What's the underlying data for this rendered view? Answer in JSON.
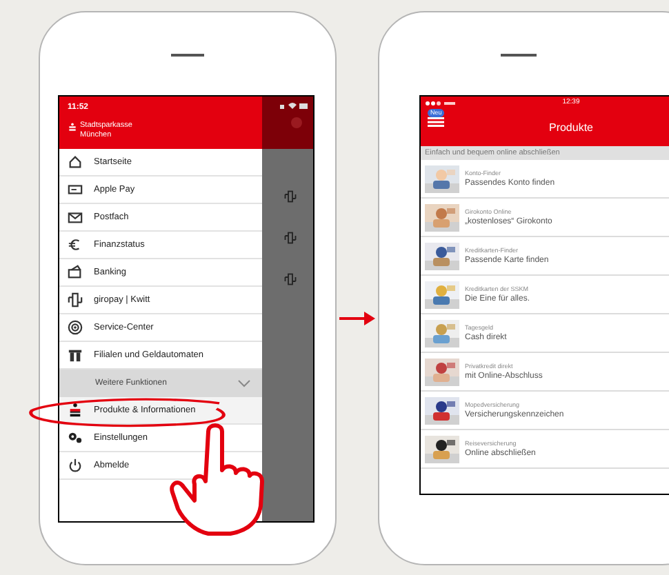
{
  "left_phone": {
    "status_time": "11:52",
    "bank_name": "Stadtsparkasse München",
    "menu_items": [
      {
        "label": "Startseite"
      },
      {
        "label": "Apple Pay"
      },
      {
        "label": "Postfach"
      },
      {
        "label": "Finanzstatus"
      },
      {
        "label": "Banking"
      },
      {
        "label": "giropay | Kwitt"
      },
      {
        "label": "Service-Center"
      },
      {
        "label": "Filialen und Geldautomaten"
      }
    ],
    "section": {
      "label": "Weitere Funktionen",
      "expanded": true
    },
    "more_items": [
      {
        "label": "Produkte & Informationen",
        "selected": true
      },
      {
        "label": "Einstellungen",
        "selected": false
      },
      {
        "label": "Abmelde",
        "selected": false
      }
    ]
  },
  "right_phone": {
    "status_time": "12:39",
    "badge": "Neu",
    "title": "Produkte",
    "subtitle": "Einfach und bequem online abschließen",
    "products": [
      {
        "kind": "picture",
        "caption": "Konto-Finder",
        "title": "Passendes Konto finden"
      },
      {
        "kind": "picture",
        "caption": "Girokonto Online",
        "title": "„kostenloses“ Girokonto"
      },
      {
        "kind": "picture",
        "caption": "Kreditkarten-Finder",
        "title": "Passende Karte finden"
      },
      {
        "kind": "picture",
        "caption": "Kreditkarten der SSKM",
        "title": "Die Eine für alles."
      },
      {
        "kind": "picture",
        "caption": "Tagesgeld",
        "title": "Cash direkt"
      },
      {
        "kind": "picture",
        "caption": "Privatkredit direkt",
        "title": "mit Online-Abschluss"
      },
      {
        "kind": "picture",
        "caption": "Mopedversicherung",
        "title": "Versicherungskennzeichen"
      },
      {
        "kind": "picture",
        "caption": "Reiseversicherung",
        "title": "Online abschließen"
      }
    ]
  }
}
